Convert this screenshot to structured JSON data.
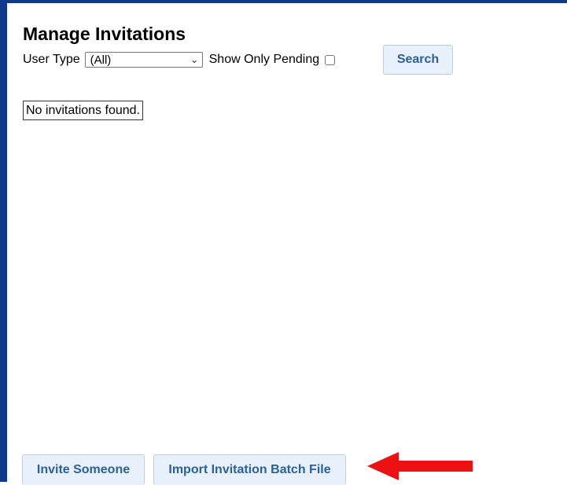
{
  "page": {
    "title": "Manage Invitations"
  },
  "filters": {
    "user_type_label": "User Type",
    "user_type_selected": "(All)",
    "show_only_pending_label": "Show Only Pending",
    "show_only_pending_checked": false
  },
  "actions": {
    "search_label": "Search",
    "invite_someone_label": "Invite Someone",
    "import_batch_label": "Import Invitation Batch File"
  },
  "results": {
    "empty_message": "No invitations found."
  },
  "icons": {
    "select_caret": "chevron-down-icon",
    "annotation_arrow": "left-arrow-icon"
  },
  "colors": {
    "frame_border": "#0f3a8c",
    "button_bg": "#e8f1fb",
    "button_text": "#2b6099",
    "annotation_arrow": "#ee1111"
  }
}
